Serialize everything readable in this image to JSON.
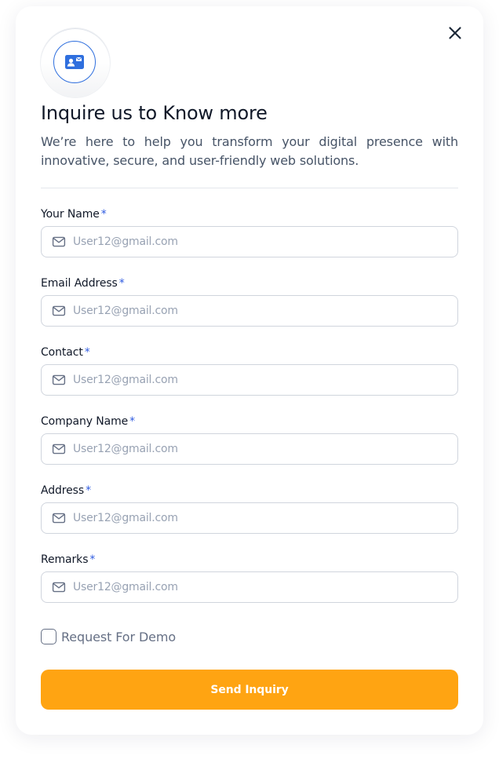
{
  "dialog": {
    "title": "Inquire us to Know more",
    "subtitle": "We’re here to help you transform your digital presence with innovative, secure, and user-friendly web solutions.",
    "close_icon": "close-icon",
    "badge_icon": "contact-card-icon"
  },
  "form": {
    "required_marker": "*",
    "fields": [
      {
        "label": "Your Name",
        "placeholder": "User12@gmail.com",
        "value": "",
        "icon": "mail-icon"
      },
      {
        "label": "Email Address",
        "placeholder": "User12@gmail.com",
        "value": "",
        "icon": "mail-icon"
      },
      {
        "label": "Contact",
        "placeholder": "User12@gmail.com",
        "value": "",
        "icon": "mail-icon"
      },
      {
        "label": "Company Name",
        "placeholder": "User12@gmail.com",
        "value": "",
        "icon": "mail-icon"
      },
      {
        "label": "Address",
        "placeholder": "User12@gmail.com",
        "value": "",
        "icon": "mail-icon"
      },
      {
        "label": "Remarks",
        "placeholder": "User12@gmail.com",
        "value": "",
        "icon": "mail-icon"
      }
    ],
    "demo_checkbox": {
      "label": "Request For Demo",
      "checked": false
    },
    "submit_label": "Send Inquiry"
  },
  "colors": {
    "accent": "#FFA412",
    "brand_blue": "#2F6FDE",
    "required": "#2F5BE0",
    "title": "#101828",
    "body_text": "#475467",
    "placeholder": "#98A2B3",
    "border": "#D0D5DD"
  }
}
